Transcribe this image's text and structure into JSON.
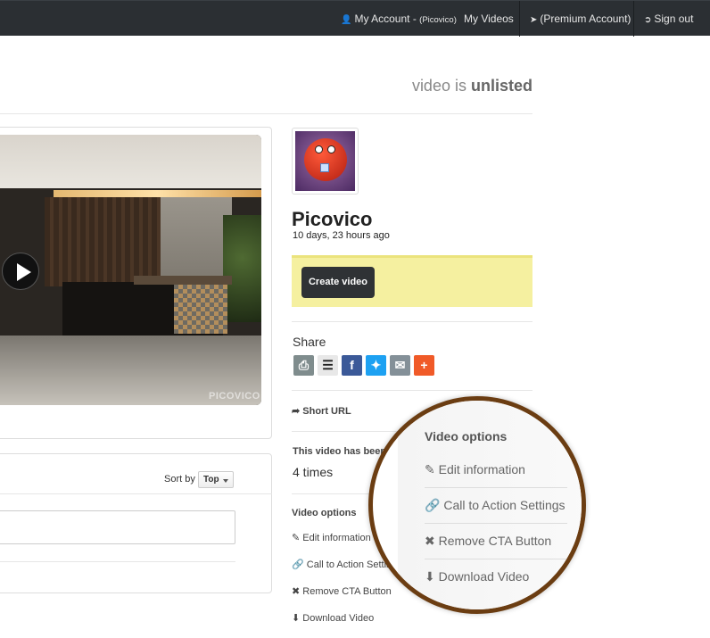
{
  "nav": {
    "my_account": "My Account -",
    "account_name": "(Picovico)",
    "my_videos": "My Videos",
    "premium": "(Premium Account)",
    "sign_out": "Sign out"
  },
  "status": {
    "prefix": "video is",
    "value": "unlisted"
  },
  "video": {
    "watermark": "PICOVICO"
  },
  "comments": {
    "sort_label": "Sort by",
    "sort_value": "Top"
  },
  "profile": {
    "name": "Picovico",
    "time_ago": "10 days, 23 hours ago"
  },
  "create_button": "Create video",
  "share": {
    "title": "Share"
  },
  "short_url": "Short URL",
  "views": {
    "label": "This video has been",
    "count": "4 times"
  },
  "video_options": {
    "title": "Video options",
    "items": [
      "Edit information",
      "Call to Action Settings",
      "Remove CTA Button",
      "Download Video"
    ]
  },
  "magnified": {
    "title": "Video options",
    "items": [
      "Edit information",
      "Call to Action Settings",
      "Remove CTA Button",
      "Download Video"
    ]
  },
  "colors": {
    "topbar": "#2b2f33",
    "highlight_box": "#f5f0a0",
    "magnifier_ring": "#6b3d12"
  }
}
